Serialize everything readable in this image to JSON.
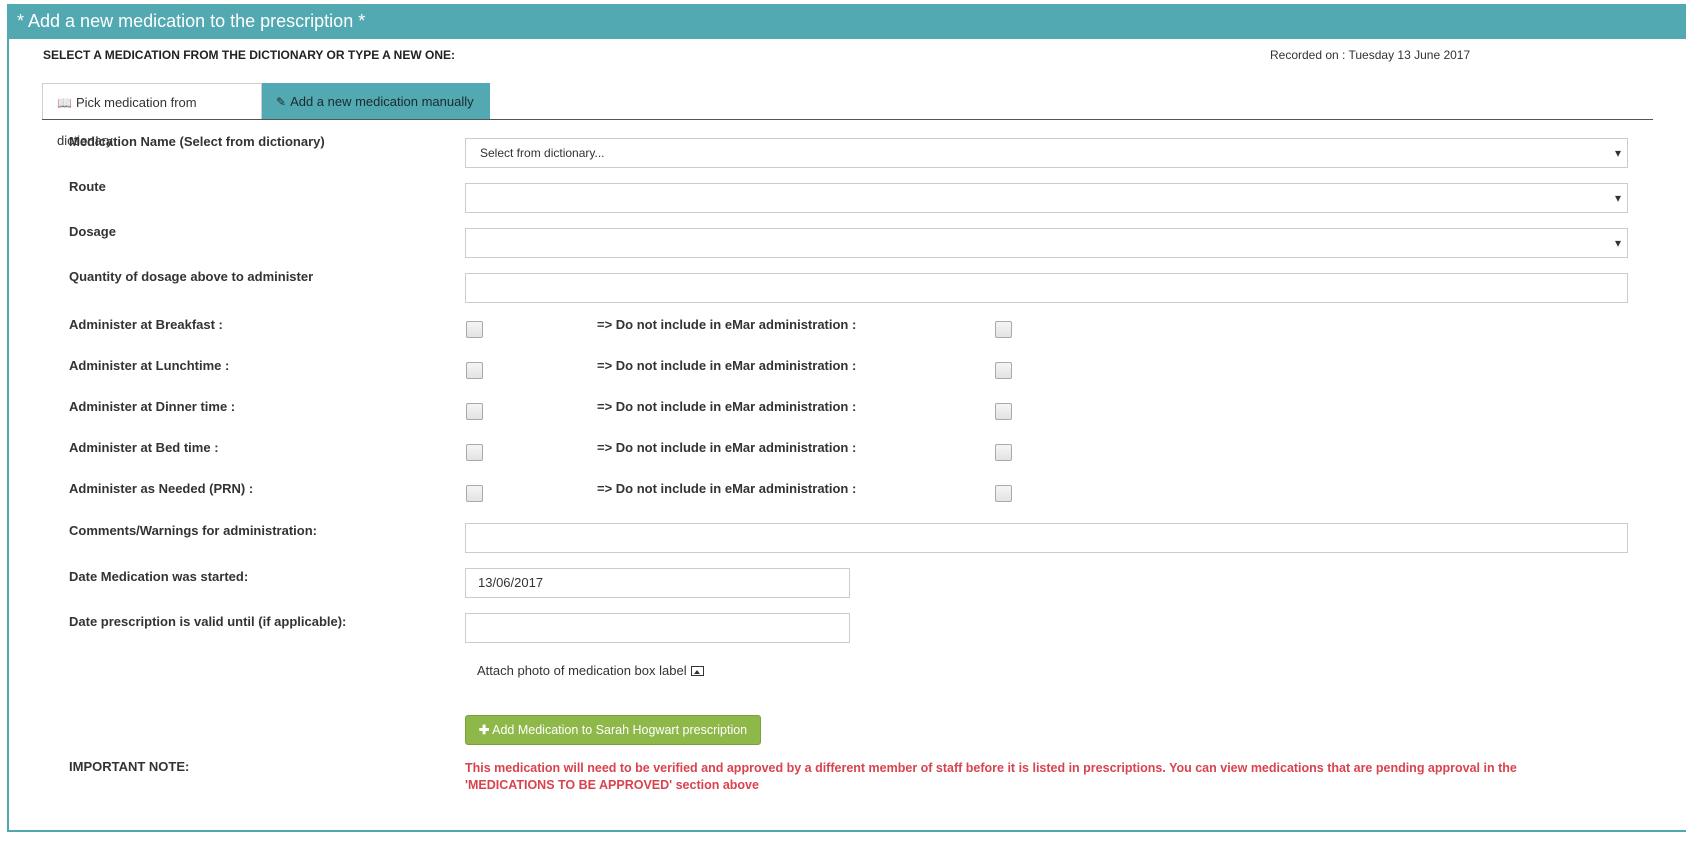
{
  "header": {
    "title": "* Add a new medication to the prescription *"
  },
  "instruction": "SELECT A MEDICATION FROM THE DICTIONARY OR TYPE A NEW ONE:",
  "recorded_on": "Recorded on : Tuesday 13 June 2017",
  "tabs": [
    {
      "label": "Pick medication from dictionary",
      "icon": "book-icon",
      "active": false
    },
    {
      "label": "Add a new medication manually",
      "icon": "edit-icon",
      "active": true
    }
  ],
  "form": {
    "medication_name": {
      "label": "Medication Name (Select from dictionary)",
      "value": "Select from dictionary..."
    },
    "route": {
      "label": "Route",
      "value": ""
    },
    "dosage": {
      "label": "Dosage",
      "value": ""
    },
    "quantity": {
      "label": "Quantity of dosage above to administer",
      "value": ""
    },
    "administer": [
      {
        "label": "Administer at Breakfast :",
        "emar_label": "=> Do not include in eMar administration :"
      },
      {
        "label": "Administer at Lunchtime :",
        "emar_label": "=> Do not include in eMar administration :"
      },
      {
        "label": "Administer at Dinner time :",
        "emar_label": "=> Do not include in eMar administration :"
      },
      {
        "label": "Administer at Bed time :",
        "emar_label": "=> Do not include in eMar administration :"
      },
      {
        "label": "Administer as Needed (PRN) :",
        "emar_label": "=> Do not include in eMar administration :"
      }
    ],
    "comments": {
      "label": "Comments/Warnings for administration:",
      "value": ""
    },
    "date_started": {
      "label": "Date Medication was started:",
      "value": "13/06/2017"
    },
    "date_valid_until": {
      "label": "Date prescription is valid until (if applicable):",
      "value": ""
    },
    "attach_photo": "Attach photo of medication box label",
    "add_button": "Add Medication to Sarah Hogwart prescription"
  },
  "note": {
    "label": "IMPORTANT NOTE:",
    "text": "This medication will need to be verified and approved by a different member of staff before it is listed in prescriptions. You can view medications that are pending approval in the 'MEDICATIONS TO BE APPROVED' section above"
  },
  "colors": {
    "header_bg": "#52a9b1",
    "button_bg": "#8fb84a",
    "note_text": "#d9434e"
  }
}
